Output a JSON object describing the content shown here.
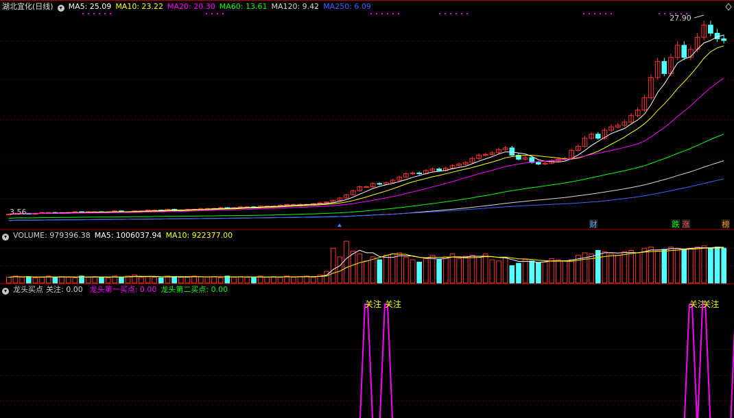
{
  "colors": {
    "up": "#ff3232",
    "down": "#54ffff",
    "ma5": "#ffffff",
    "ma10": "#ffff00",
    "ma20": "#ff00ff",
    "ma60": "#00ff00",
    "ma120": "#d8d8d8",
    "ma250": "#3c64ff",
    "grid": "#7a0000",
    "signal": "#ff00ff",
    "signal_label": "#ffff00"
  },
  "price_panel": {
    "title": "湖北宜化(日线)",
    "collapse_icon": "chevron-down-icon",
    "ma5": "MA5: 25.09",
    "ma10": "MA10: 23.22",
    "ma20": "MA20: 20.30",
    "ma60": "MA60: 13.61",
    "ma120": "MA120: 9.42",
    "ma250": "MA250: 6.09",
    "high_label": "27.90",
    "low_label": "3.56",
    "markers": [
      {
        "text": "财",
        "color": "#60a8ff"
      },
      {
        "text": "跌",
        "color": "#00ff00"
      },
      {
        "text": "涨",
        "color": "#ff5050"
      },
      {
        "text": "榜",
        "color": "#ff9900"
      }
    ]
  },
  "volume_panel": {
    "title": "VOLUME: 979396.38",
    "ma5": "MA5: 1006037.94",
    "ma10": "MA10: 922377.00"
  },
  "indicator_panel": {
    "name": "龙头买点",
    "guanzhu": "关注: 0.00",
    "buy1": "龙头第一买点: 0.00",
    "buy2": "龙头第二买点: 0.00",
    "signal_text": "关注"
  },
  "chart_data": {
    "type": "candlestick",
    "title": "湖北宜化(日线)",
    "price_range": [
      3.56,
      27.9
    ],
    "annotations": [
      "27.90",
      "3.56"
    ],
    "series": [
      {
        "name": "MA5",
        "value": 25.09
      },
      {
        "name": "MA10",
        "value": 23.22
      },
      {
        "name": "MA20",
        "value": 20.3
      },
      {
        "name": "MA60",
        "value": 13.61
      },
      {
        "name": "MA120",
        "value": 9.42
      },
      {
        "name": "MA250",
        "value": 6.09
      }
    ],
    "close": [
      3.6,
      3.7,
      3.7,
      3.6,
      3.7,
      3.8,
      3.8,
      3.7,
      3.8,
      3.8,
      3.9,
      3.8,
      3.9,
      3.9,
      3.8,
      3.9,
      4.0,
      3.9,
      3.9,
      4.0,
      4.0,
      4.1,
      4.1,
      4.0,
      4.2,
      4.1,
      4.1,
      4.2,
      4.2,
      4.3,
      4.3,
      4.3,
      4.4,
      4.3,
      4.4,
      4.5,
      4.5,
      4.4,
      4.6,
      4.6,
      4.6,
      4.7,
      4.8,
      4.8,
      4.8,
      4.8,
      4.9,
      5.0,
      5.1,
      5.3,
      5.6,
      6.0,
      6.5,
      7.0,
      7.0,
      7.4,
      7.3,
      7.5,
      7.8,
      8.2,
      8.6,
      8.7,
      8.6,
      9.0,
      9.2,
      9.0,
      9.3,
      9.6,
      9.8,
      10.0,
      10.5,
      10.9,
      11.0,
      11.2,
      11.6,
      11.8,
      10.9,
      10.4,
      10.6,
      10.0,
      9.8,
      9.9,
      10.2,
      10.4,
      10.5,
      11.5,
      12.0,
      13.0,
      13.5,
      13.0,
      14.0,
      14.4,
      14.6,
      15.0,
      15.8,
      16.5,
      18.0,
      20.5,
      22.5,
      21.0,
      23.0,
      24.5,
      23.0,
      24.0,
      25.5,
      27.0,
      26.0,
      25.3,
      25.09
    ],
    "volume": [
      0.1,
      0.12,
      0.1,
      0.11,
      0.09,
      0.1,
      0.12,
      0.1,
      0.11,
      0.1,
      0.09,
      0.12,
      0.1,
      0.11,
      0.1,
      0.09,
      0.12,
      0.1,
      0.12,
      0.14,
      0.1,
      0.11,
      0.1,
      0.09,
      0.12,
      0.11,
      0.1,
      0.1,
      0.12,
      0.11,
      0.1,
      0.11,
      0.09,
      0.12,
      0.1,
      0.11,
      0.1,
      0.09,
      0.12,
      0.1,
      0.11,
      0.1,
      0.12,
      0.1,
      0.11,
      0.12,
      0.1,
      0.14,
      0.2,
      0.6,
      0.45,
      0.72,
      0.55,
      0.5,
      0.38,
      0.45,
      0.4,
      0.48,
      0.5,
      0.52,
      0.44,
      0.4,
      0.36,
      0.42,
      0.48,
      0.4,
      0.45,
      0.5,
      0.42,
      0.46,
      0.48,
      0.44,
      0.5,
      0.4,
      0.38,
      0.44,
      0.3,
      0.34,
      0.4,
      0.38,
      0.35,
      0.36,
      0.42,
      0.4,
      0.38,
      0.4,
      0.48,
      0.52,
      0.5,
      0.56,
      0.54,
      0.5,
      0.48,
      0.54,
      0.56,
      0.52,
      0.6,
      0.62,
      0.55,
      0.58,
      0.62,
      0.6,
      0.58,
      0.6,
      0.62,
      0.64,
      0.6,
      0.62,
      0.6
    ],
    "signals": [
      54,
      57,
      103,
      105,
      110
    ]
  }
}
